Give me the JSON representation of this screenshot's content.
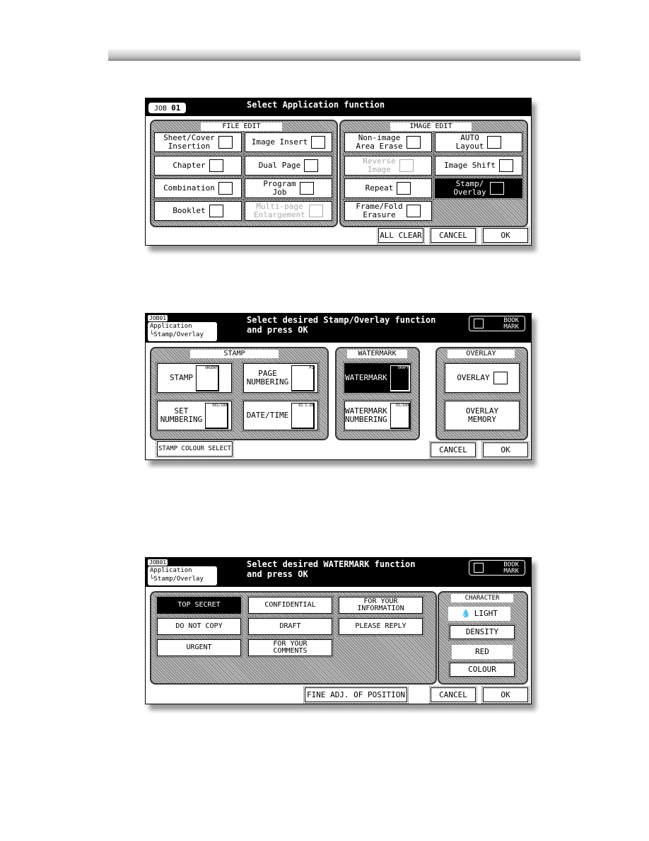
{
  "screen1": {
    "job_label": "JOB",
    "job_number": "01",
    "title": "Select Application function",
    "file_edit": {
      "label": "FILE EDIT",
      "buttons": [
        {
          "label": "Sheet/Cover\nInsertion",
          "icon": "sheet-cover-icon"
        },
        {
          "label": "Image Insert",
          "icon": "image-insert-icon"
        },
        {
          "label": "Chapter",
          "icon": "chapter-icon"
        },
        {
          "label": "Dual Page",
          "icon": "dual-page-icon"
        },
        {
          "label": "Combination",
          "icon": "combination-icon"
        },
        {
          "label": "Program\nJob",
          "icon": "program-job-icon"
        },
        {
          "label": "Booklet",
          "icon": "booklet-icon"
        },
        {
          "label": "Multi-page\nEnlargement",
          "icon": "enlargement-icon",
          "disabled": true
        }
      ]
    },
    "image_edit": {
      "label": "IMAGE EDIT",
      "buttons": [
        {
          "label": "Non-image\nArea Erase",
          "icon": "erase-icon"
        },
        {
          "label": "AUTO\nLayout",
          "icon": "layout-icon"
        },
        {
          "label": "Reverse\nImage",
          "icon": "reverse-icon",
          "disabled": true
        },
        {
          "label": "Image Shift",
          "icon": "shift-icon"
        },
        {
          "label": "Repeat",
          "icon": "repeat-icon"
        },
        {
          "label": "Stamp/\nOverlay",
          "icon": "stamp-icon",
          "selected": true
        },
        {
          "label": "Frame/Fold\nErasure",
          "icon": "frame-fold-icon"
        }
      ]
    },
    "all_clear": "ALL CLEAR",
    "cancel": "CANCEL",
    "ok": "OK"
  },
  "screen2": {
    "job": "JOB01",
    "crumb1": "Application",
    "crumb2": "└Stamp/Overlay",
    "title": "Select desired Stamp/Overlay function\nand press OK",
    "bookmark": "BOOK\nMARK",
    "stamp": {
      "label": "STAMP",
      "buttons": [
        {
          "label": "STAMP",
          "icon_text": "URGENT"
        },
        {
          "label": "PAGE\nNUMBERING",
          "icon_text": "P1"
        },
        {
          "label": "SET\nNUMBERING",
          "icon_text": "001/100"
        },
        {
          "label": "DATE/TIME",
          "icon_text": "02.1.20"
        }
      ]
    },
    "watermark": {
      "label": "WATERMARK",
      "buttons": [
        {
          "label": "WATERMARK",
          "icon_text": "DRAFT",
          "selected": true
        },
        {
          "label": "WATERMARK\nNUMBERING",
          "icon_text": "01/100"
        }
      ]
    },
    "overlay": {
      "label": "OVERLAY",
      "buttons": [
        {
          "label": "OVERLAY"
        },
        {
          "label": "OVERLAY\nMEMORY"
        }
      ]
    },
    "stamp_colour": "STAMP COLOUR SELECT",
    "cancel": "CANCEL",
    "ok": "OK"
  },
  "screen3": {
    "job": "JOB01",
    "crumb1": "Application",
    "crumb2": "└Stamp/Overlay",
    "title": "Select desired WATERMARK function\nand press OK",
    "bookmark": "BOOK\nMARK",
    "options": [
      {
        "label": "TOP SECRET",
        "selected": true
      },
      {
        "label": "CONFIDENTIAL"
      },
      {
        "label": "FOR YOUR\nINFORMATION"
      },
      {
        "label": "DO NOT COPY"
      },
      {
        "label": "DRAFT"
      },
      {
        "label": "PLEASE REPLY"
      },
      {
        "label": "URGENT"
      },
      {
        "label": "FOR YOUR\nCOMMENTS"
      }
    ],
    "character": {
      "label": "CHARACTER",
      "density_value": "LIGHT",
      "density": "DENSITY",
      "colour_value": "RED",
      "colour": "COLOUR"
    },
    "fine_adj": "FINE ADJ. OF POSITION",
    "cancel": "CANCEL",
    "ok": "OK"
  }
}
